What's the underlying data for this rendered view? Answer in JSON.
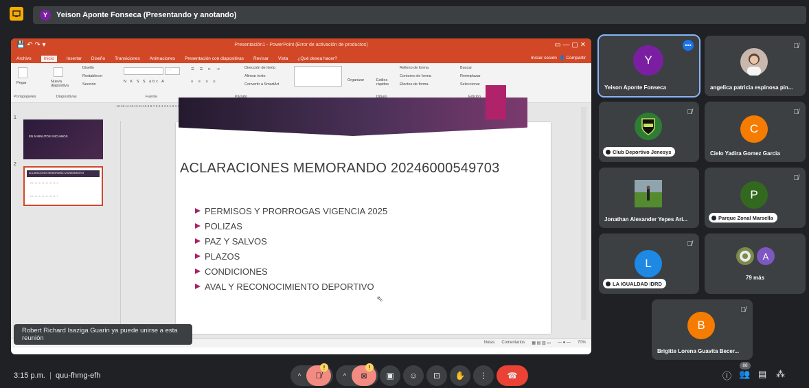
{
  "header": {
    "presenter_initial": "Y",
    "presenter_label": "Yeison Aponte Fonseca (Presentando y anotando)"
  },
  "powerpoint": {
    "title": "Presentación1 - PowerPoint (Error de activación de productos)",
    "tabs": [
      "Archivo",
      "Inicio",
      "Insertar",
      "Diseño",
      "Transiciones",
      "Animaciones",
      "Presentación con diapositivas",
      "Revisar",
      "Vista",
      "¿Qué desea hacer?"
    ],
    "active_tab": "Inicio",
    "signin": "Iniciar sesión",
    "share": "Compartir",
    "ribbon_groups": [
      "Portapapeles",
      "Diapositivas",
      "Fuente",
      "Párrafo",
      "Dibujo",
      "Edición"
    ],
    "ribbon_items": {
      "paste": "Pegar",
      "new_slide": "Nueva diapositiva",
      "layout": "Diseño",
      "reset": "Restablecer",
      "section": "Sección",
      "font_size": "24",
      "text_direction": "Dirección del texto",
      "align_text": "Alinear texto",
      "smartart": "Convertir a SmartArt",
      "arrange": "Organizar",
      "quick_styles": "Estilos rápidos",
      "shape_fill": "Relleno de forma",
      "shape_outline": "Contorno de forma",
      "shape_effects": "Efectos de forma",
      "find": "Buscar",
      "replace": "Reemplazar",
      "select": "Seleccionar"
    },
    "ruler_text": "·16·15·14·13·12·11·10·9·8·7·6·5·4·3·2·1·0·1·2·3·4·5·6·7·8·9·10·11·12·13·14·15·16·",
    "thumbnails": [
      {
        "num": "1",
        "title": "EN 5 MINUTOS INICIAMOS"
      },
      {
        "num": "2",
        "title": "ACLARACIONES MEMORANDO 20246000549703"
      }
    ],
    "slide": {
      "heading": "ACLARACIONES MEMORANDO 20246000549703",
      "bullets": [
        "PERMISOS Y PRORROGAS VIGENCIA 2025",
        "POLIZAS",
        "PAZ Y SALVOS",
        "PLAZOS",
        "CONDICIONES",
        "AVAL Y RECONOCIMIENTO DEPORTIVO"
      ]
    },
    "status": {
      "notes": "Notas",
      "comments": "Comentarios",
      "zoom": "70%"
    }
  },
  "toast": "Robert Richard Isaziga Guarin ya puede unirse a esta reunión",
  "participants": [
    {
      "name": "Yeison Aponte Fonseca",
      "initial": "Y",
      "color": "#7b1fa2"
    },
    {
      "name": "angelica patricia espinosa pin..."
    },
    {
      "name": "Club Deportivo Jenesys"
    },
    {
      "name": "Cielo Yadira Gomez Garcia",
      "initial": "C",
      "color": "#f57c00"
    },
    {
      "name": "Jonathan Alexander Yepes Ari..."
    },
    {
      "name": "Parque Zonal Marsella",
      "initial": "P",
      "color": "#33691e"
    },
    {
      "name": "LA IGUALDAD IDRD",
      "initial": "L",
      "color": "#1e88e5"
    },
    {
      "name": "79 más",
      "initial": "A",
      "color": "#7e57c2"
    },
    {
      "name": "Brigitte Lorena Guavita Becer...",
      "initial": "B",
      "color": "#f57c00"
    }
  ],
  "footer": {
    "time": "3:15 p.m.",
    "meeting_code": "quu-fhmg-efh",
    "people_count": "88"
  }
}
